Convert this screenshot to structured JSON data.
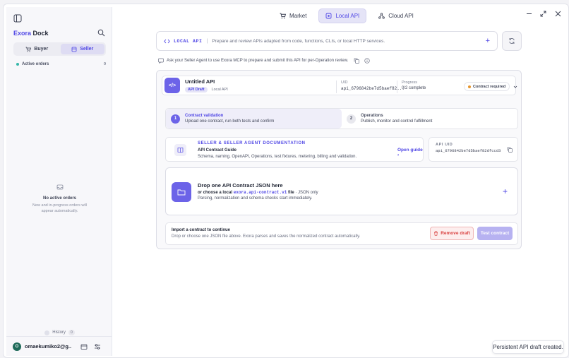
{
  "sidebar": {
    "brand_part1": "Exora",
    "brand_part2": "Dock",
    "roles": [
      "Buyer",
      "Seller"
    ],
    "active_role": "Seller",
    "active_orders_label": "Active orders",
    "active_orders_count": "0",
    "empty_title": "No active orders",
    "empty_text": "New and in-progress orders will appear automatically.",
    "history_label": "History",
    "history_count": "0",
    "user_initial": "O",
    "user_name": "omaekumiko2@g..."
  },
  "tabs": [
    "Market",
    "Local API",
    "Cloud API"
  ],
  "active_tab": "Local API",
  "command_bar": {
    "tag": "LOCAL API",
    "sep": "|",
    "description": "Prepare and review APIs adapted from code, functions, CLIs, or local HTTP services."
  },
  "hint": "Ask your Seller Agent to use Exora MCP to prepare and submit this API for per-Operation review.",
  "api": {
    "icon_text": "</>",
    "name": "Untitled API",
    "badge": "API Draft",
    "type": "Local API",
    "uid_label": "UID",
    "uid_value": "api_6796842be7d5baef82...",
    "progress_label": "Progress",
    "progress_value": "0/2 complete",
    "status": "Contract required"
  },
  "steps": [
    {
      "num": "1",
      "title": "Contract validation",
      "subtitle": "Upload one contract, run both tests and confirm"
    },
    {
      "num": "2",
      "title": "Operations",
      "subtitle": "Publish, monitor and control fulfillment"
    }
  ],
  "doc": {
    "title": "SELLER & SELLER AGENT DOCUMENTATION",
    "guide": "API Contract Guide",
    "description": "Schema, naming, OpenAPI, Operations, test fixtures, metering, billing and validation.",
    "open_label": "Open guide"
  },
  "api_uid": {
    "label": "API UID",
    "value": "api_6796842be7d5baef82dfccd3"
  },
  "drop": {
    "title": "Drop one API Contract JSON here",
    "line_prefix": "or choose a local",
    "filename": "exora.api-contract.v1",
    "line_suffix": "file",
    "only": "· JSON only",
    "note": "Parsing, normalization and schema checks start immediately."
  },
  "footer": {
    "title": "Import a contract to continue",
    "description": "Drop or choose one JSON file above. Exora parses and saves the normalized contract automatically.",
    "remove_label": "Remove draft",
    "test_label": "Test contract"
  },
  "toast": "Persistent API draft created.",
  "colors": {
    "accent": "#4f46e5",
    "accent_fill": "#6c63e8",
    "danger": "#d9403f",
    "teal": "#36b7a9",
    "warning": "#e6962f"
  }
}
